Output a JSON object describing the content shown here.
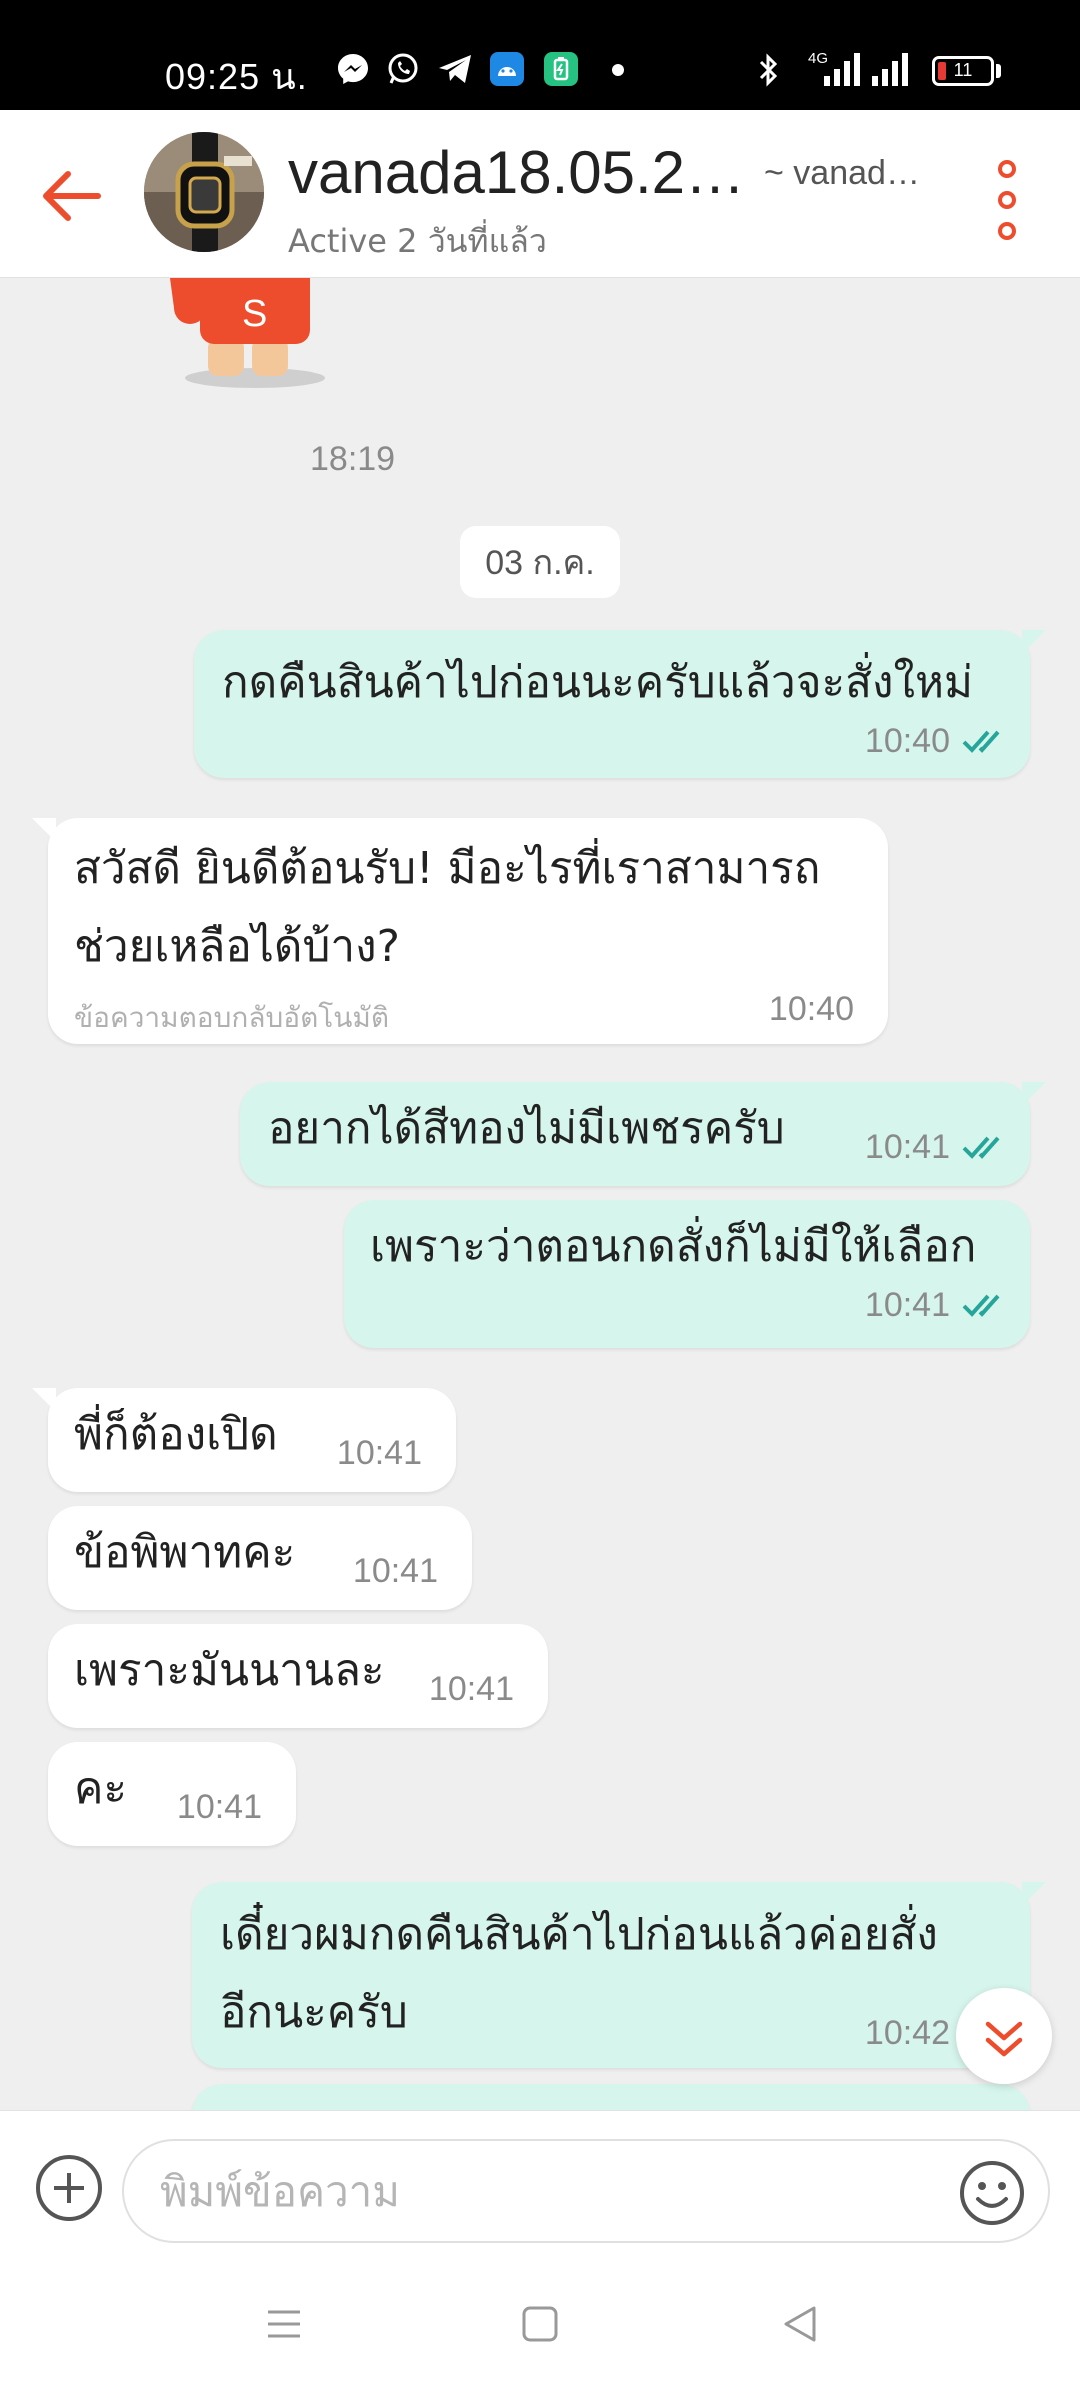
{
  "status_bar": {
    "time": "09:25 น.",
    "network": "4G",
    "battery": "11"
  },
  "header": {
    "title": "vanada18.05.2…",
    "username": "~ vanad…",
    "status": "Active 2 วันที่แล้ว"
  },
  "chat": {
    "time_separator": "18:19",
    "date_chip": "03 ก.ค.",
    "messages": [
      {
        "direction": "out",
        "text": "กดคืนสินค้าไปก่อนนะครับแล้วจะสั่งใหม่",
        "time": "10:40"
      },
      {
        "direction": "in",
        "text": "สวัสดี ยินดีต้อนรับ! มีอะไรที่เราสามารถ\nช่วยเหลือได้บ้าง?",
        "time": "10:40",
        "note": "ข้อความตอบกลับอัตโนมัติ"
      },
      {
        "direction": "out",
        "text": "อยากได้สีทองไม่มีเพชรครับ",
        "time": "10:41"
      },
      {
        "direction": "out",
        "text": "เพราะว่าตอนกดสั่งก็ไม่มีให้เลือก",
        "time": "10:41"
      },
      {
        "direction": "in",
        "text": "พี่ก็ต้องเปิด",
        "time": "10:41"
      },
      {
        "direction": "in",
        "text": "ข้อพิพาทคะ",
        "time": "10:41"
      },
      {
        "direction": "in",
        "text": "เพราะมันนานละ",
        "time": "10:41"
      },
      {
        "direction": "in",
        "text": "คะ",
        "time": "10:41"
      },
      {
        "direction": "out",
        "text": "เดี๋ยวผมกดคืนสินค้าไปก่อนแล้วค่อยสั่ง\nอีกนะครับ",
        "time": "10:42"
      }
    ]
  },
  "input": {
    "placeholder": "พิมพ์ข้อความ"
  },
  "icons": {
    "back": "arrow-left-icon",
    "more": "more-vertical-icon",
    "read": "double-check-icon",
    "scroll": "chevron-double-down-icon",
    "add": "plus-circle-icon",
    "emoji": "smiley-icon"
  },
  "colors": {
    "accent": "#ee4d2d",
    "outgoing_bubble": "#d6f5ec",
    "incoming_bubble": "#ffffff",
    "read_tick": "#26a69a"
  }
}
